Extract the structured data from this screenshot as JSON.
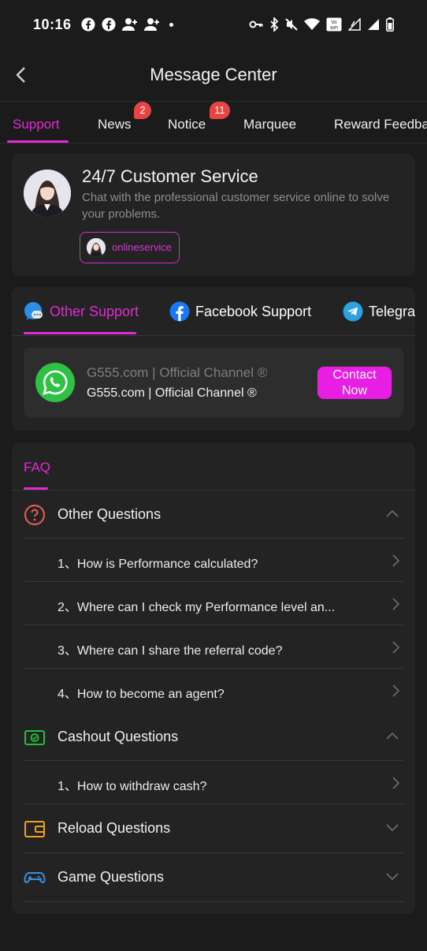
{
  "status_bar": {
    "time": "10:16"
  },
  "header": {
    "title": "Message Center"
  },
  "tabs": [
    {
      "label": "Support",
      "active": true
    },
    {
      "label": "News",
      "badge": "2"
    },
    {
      "label": "Notice",
      "badge": "11"
    },
    {
      "label": "Marquee"
    },
    {
      "label": "Reward Feedba"
    }
  ],
  "customer_service": {
    "title": "24/7 Customer Service",
    "description": "Chat with the professional customer service online to solve your problems.",
    "agent_name": "onlineservice"
  },
  "support_tabs": [
    {
      "label": "Other Support",
      "active": true,
      "icon": "chat-bubble-icon"
    },
    {
      "label": "Facebook Support",
      "icon": "facebook-icon"
    },
    {
      "label": "Telegra",
      "icon": "telegram-icon"
    }
  ],
  "channel": {
    "name": "G555.com | Official Channel ®",
    "subtitle": "G555.com | Official Channel ®",
    "button": "Contact Now"
  },
  "faq": {
    "tab": "FAQ",
    "categories": [
      {
        "label": "Other Questions",
        "icon": "question-circle-icon",
        "expanded": true,
        "questions": [
          "1、How is Performance calculated?",
          "2、Where can I check my Performance level an...",
          "3、Where can I share the referral code?",
          "4、How to become an agent?"
        ]
      },
      {
        "label": "Cashout Questions",
        "icon": "cash-icon",
        "expanded": true,
        "questions": [
          "1、How to withdraw cash?"
        ]
      },
      {
        "label": "Reload Questions",
        "icon": "wallet-icon",
        "expanded": false,
        "questions": []
      },
      {
        "label": "Game Questions",
        "icon": "gamepad-icon",
        "expanded": false,
        "questions": []
      }
    ]
  },
  "colors": {
    "accent": "#e22ad7",
    "badge": "#e94444",
    "background": "#1b1b1b",
    "card": "#232323"
  }
}
